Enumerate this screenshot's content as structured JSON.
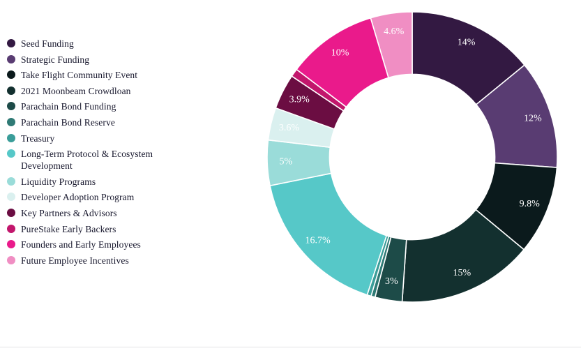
{
  "chart_data": {
    "type": "pie",
    "variant": "donut",
    "title": "",
    "subtitle": "",
    "xlabel": "",
    "ylabel": "",
    "legend_position": "left",
    "grid": false,
    "start_angle_deg": 0,
    "direction": "clockwise",
    "inner_radius_ratio": 0.57,
    "label_format": "percent",
    "categories": [
      "Seed Funding",
      "Strategic Funding",
      "Take Flight Community Event",
      "2021 Moonbeam Crowdloan",
      "Parachain Bond Funding",
      "Parachain Bond Reserve",
      "Treasury",
      "Long-Term Protocol & Ecosystem Development",
      "Liquidity Programs",
      "Developer Adoption Program",
      "Key Partners & Advisors",
      "PureStake Early Backers",
      "Founders and Early Employees",
      "Future Employee Incentives"
    ],
    "values": [
      14,
      12,
      9.8,
      15,
      3,
      0.45,
      0.45,
      16.7,
      5,
      3.6,
      3.9,
      0.9,
      10,
      4.6
    ],
    "colors": [
      "#331942",
      "#593c72",
      "#0b1a1c",
      "#13302f",
      "#1d4b48",
      "#2f7a75",
      "#3a9d99",
      "#56c8c8",
      "#9adcd9",
      "#daf0ef",
      "#6b0d42",
      "#c2166c",
      "#ea1a8b",
      "#f08ec3"
    ],
    "point_labels": [
      "14%",
      "12%",
      "9.8%",
      "15%",
      "3%",
      "",
      "",
      "16.7%",
      "5%",
      "3.6%",
      "3.9%",
      "",
      "10%",
      "4.6%"
    ]
  },
  "legend": {
    "items": [
      {
        "label": "Seed Funding",
        "color": "#331942"
      },
      {
        "label": "Strategic Funding",
        "color": "#593c72"
      },
      {
        "label": "Take Flight Community Event",
        "color": "#0b1a1c"
      },
      {
        "label": "2021 Moonbeam Crowdloan",
        "color": "#13302f"
      },
      {
        "label": "Parachain Bond Funding",
        "color": "#1d4b48"
      },
      {
        "label": "Parachain Bond Reserve",
        "color": "#2f7a75"
      },
      {
        "label": "Treasury",
        "color": "#3a9d99"
      },
      {
        "label": "Long-Term Protocol & Ecosystem Development",
        "color": "#56c8c8"
      },
      {
        "label": "Liquidity Programs",
        "color": "#9adcd9"
      },
      {
        "label": "Developer Adoption Program",
        "color": "#daf0ef"
      },
      {
        "label": "Key Partners & Advisors",
        "color": "#6b0d42"
      },
      {
        "label": "PureStake Early Backers",
        "color": "#c2166c"
      },
      {
        "label": "Founders and Early Employees",
        "color": "#ea1a8b"
      },
      {
        "label": "Future Employee Incentives",
        "color": "#f08ec3"
      }
    ]
  },
  "theme": {
    "background": "#ffffff",
    "slice_border": "#ffffff",
    "label_text": "#ffffff",
    "legend_text": "#15152b",
    "divider": "#e3e3e6"
  }
}
